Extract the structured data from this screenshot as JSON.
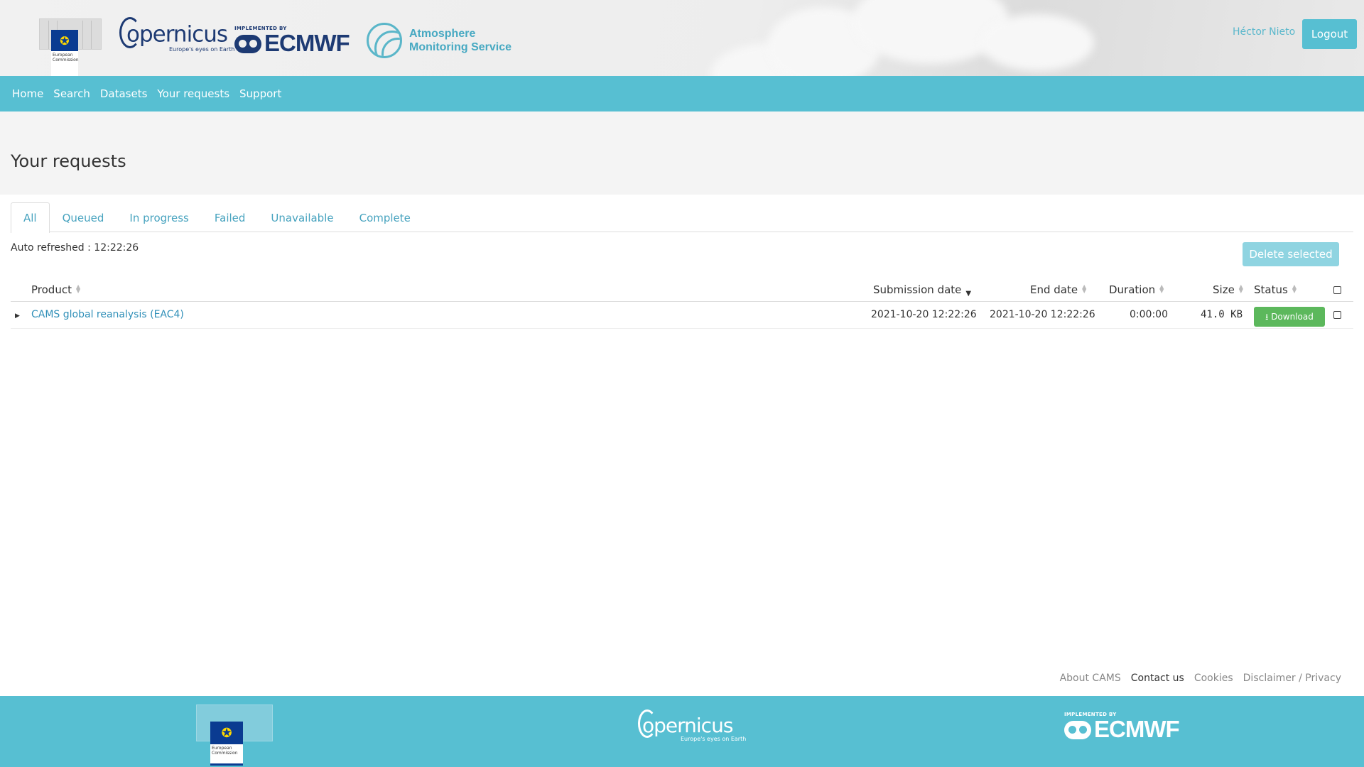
{
  "header": {
    "ec_logo_text": "European Commission",
    "copernicus_word": "opernicus",
    "copernicus_tagline": "Europe's eyes on Earth",
    "ecmwf_implemented": "IMPLEMENTED BY",
    "ecmwf_word": "ECMWF",
    "ams_line1": "Atmosphere",
    "ams_line2": "Monitoring Service",
    "user_name": "Héctor Nieto",
    "logout_label": "Logout"
  },
  "nav": {
    "items": [
      "Home",
      "Search",
      "Datasets",
      "Your requests",
      "Support"
    ]
  },
  "page": {
    "title": "Your requests"
  },
  "tabs": [
    "All",
    "Queued",
    "In progress",
    "Failed",
    "Unavailable",
    "Complete"
  ],
  "active_tab": "All",
  "toolbar": {
    "auto_refreshed": "Auto refreshed : 12:22:26",
    "delete_selected_label": "Delete selected"
  },
  "table": {
    "columns": [
      "Product",
      "Submission date",
      "End date",
      "Duration",
      "Size",
      "Status"
    ],
    "sorted_by": "Submission date",
    "sort_direction": "descending",
    "rows": [
      {
        "product": "CAMS global reanalysis (EAC4)",
        "submission_date": "2021-10-20 12:22:26",
        "end_date": "2021-10-20 12:22:26",
        "duration": "0:00:00",
        "size": "41.0 KB",
        "status_button": "Download"
      }
    ]
  },
  "footer": {
    "links": [
      "About CAMS",
      "Contact us",
      "Cookies",
      "Disclaimer / Privacy"
    ]
  },
  "colors": {
    "accent": "#57bfd2",
    "link": "#2f8fb8",
    "download_green": "#5cb85c",
    "ams_text": "#47a9c2",
    "logo_navy": "#1d3a73"
  },
  "icons": {
    "download": "download-icon",
    "expand": "caret-right-icon",
    "sort": "sort-icon"
  }
}
